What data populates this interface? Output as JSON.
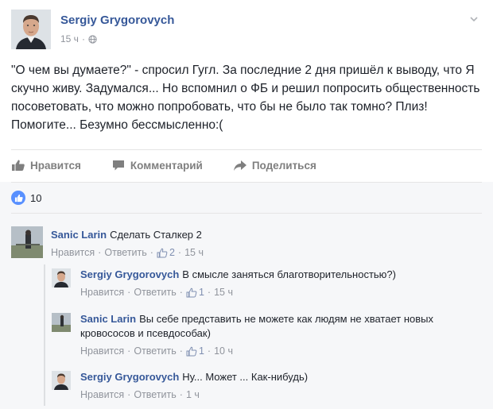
{
  "post": {
    "author": "Sergiy Grygorovych",
    "time": "15 ч",
    "meta_separator": "·",
    "privacy_icon": "globe-icon",
    "text": "\"О чем вы думаете?\" - спросил Гугл. За последние 2 дня пришёл к выводу, что Я скучно живу. Задумался... Но вспомнил о ФБ и решил попросить общественность посоветовать, что можно попробовать, что бы не было так томно? Плиз! Помогите... Безумно бессмысленно:(",
    "menu_icon": "chevron-down-icon"
  },
  "actions": {
    "like": "Нравится",
    "comment": "Комментарий",
    "share": "Поделиться"
  },
  "reactions": {
    "count": "10",
    "icon": "like-icon",
    "color": "#5890ff"
  },
  "comments": [
    {
      "author": "Sanic Larin",
      "text": "Сделать Сталкер 2",
      "like_label": "Нравится",
      "reply_label": "Ответить",
      "likes": "2",
      "time": "15 ч"
    },
    {
      "author": "Sergiy Grygorovych",
      "text": "В смысле заняться благотворительностью?)",
      "like_label": "Нравится",
      "reply_label": "Ответить",
      "likes": "1",
      "time": "15 ч"
    },
    {
      "author": "Sanic Larin",
      "text": "Вы себе представить не можете как людям не хватает новых кровососов и псевдособак)",
      "like_label": "Нравится",
      "reply_label": "Ответить",
      "likes": "1",
      "time": "10 ч"
    },
    {
      "author": "Sergiy Grygorovych",
      "text": "Ну... Может ... Как-нибудь)",
      "like_label": "Нравится",
      "reply_label": "Ответить",
      "likes": "",
      "time": "1 ч"
    }
  ],
  "separator": "·",
  "colors": {
    "link": "#365899",
    "muted": "#90949c",
    "panel": "#f6f7f9"
  }
}
